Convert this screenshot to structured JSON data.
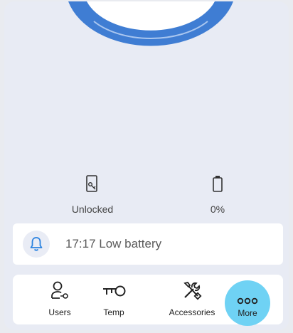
{
  "lock": {
    "status": "Unlocked",
    "icon": "phone-key-icon"
  },
  "battery": {
    "level": "0%",
    "icon": "battery-icon"
  },
  "notification": {
    "time": "17:17",
    "message": "Low battery",
    "text": "17:17 Low battery",
    "icon": "bell-icon"
  },
  "nav": {
    "items": [
      {
        "label": "Users",
        "icon": "user-key-icon"
      },
      {
        "label": "Temp",
        "icon": "temp-key-icon"
      },
      {
        "label": "Accessories",
        "icon": "tools-icon"
      },
      {
        "label": "More",
        "icon": "more-dots-icon"
      }
    ]
  },
  "colors": {
    "ring": "#3f7dd3",
    "accent": "#2a82e0",
    "more_button": "#6fd2f4",
    "background": "#e8ebf4"
  }
}
